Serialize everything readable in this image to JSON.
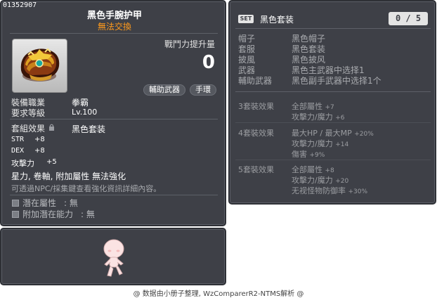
{
  "item": {
    "id": "01352907",
    "name": "黑色手腕护甲",
    "trade": "無法交換",
    "power_label": "戰鬥力提升量",
    "power_value": "0",
    "tags": [
      "輔助武器",
      "手環"
    ],
    "job_label": "裝備職業",
    "job_value": "拳霸",
    "level_label": "要求等級",
    "level_value": "Lv.100",
    "set_label": "套組效果",
    "set_value": "黑色套装",
    "stats": [
      {
        "label": "STR",
        "value": "+8"
      },
      {
        "label": "DEX",
        "value": "+8"
      },
      {
        "label": "攻擊力",
        "value": "+5"
      }
    ],
    "flags": "星力, 卷軸, 附加屬性 無法強化",
    "hint": "可透過NPC/採集鍵查看強化資訊詳細內容。",
    "potential_label": "潛在屬性",
    "potential_value": ": 無",
    "additional_label": "附加潛在能力",
    "additional_value": ": 無"
  },
  "set": {
    "badge": "SET",
    "name": "黑色套装",
    "count": "0 / 5",
    "parts": [
      {
        "type": "帽子",
        "name": "黑色帽子"
      },
      {
        "type": "套服",
        "name": "黑色套装"
      },
      {
        "type": "披風",
        "name": "黑色披风"
      },
      {
        "type": "武器",
        "name": "黑色主武器中选择1"
      },
      {
        "type": "輔助武器",
        "name": "黑色副手武器中选择1个"
      }
    ],
    "effects": [
      {
        "title": "3套裝效果",
        "lines": [
          {
            "text": "全部屬性",
            "value": "+7"
          },
          {
            "text": "攻擊力/魔力",
            "value": "+6"
          }
        ]
      },
      {
        "title": "4套裝效果",
        "lines": [
          {
            "text": "最大HP / 最大MP",
            "value": "+20%"
          },
          {
            "text": "攻擊力/魔力",
            "value": "+14"
          },
          {
            "text": "傷害",
            "value": "+9%"
          }
        ]
      },
      {
        "title": "5套裝效果",
        "lines": [
          {
            "text": "全部屬性",
            "value": "+8"
          },
          {
            "text": "攻擊力/魔力",
            "value": "+20"
          },
          {
            "text": "无视怪物防御率",
            "value": "+30%"
          }
        ]
      }
    ]
  },
  "footer": "@ 数据由小册子整理, WzComparerR2-NTMS解析 @",
  "colors": {
    "panel_bg": "#3e4047",
    "trade": "#ff9a1c",
    "badge_bg": "#e4e4e4"
  }
}
